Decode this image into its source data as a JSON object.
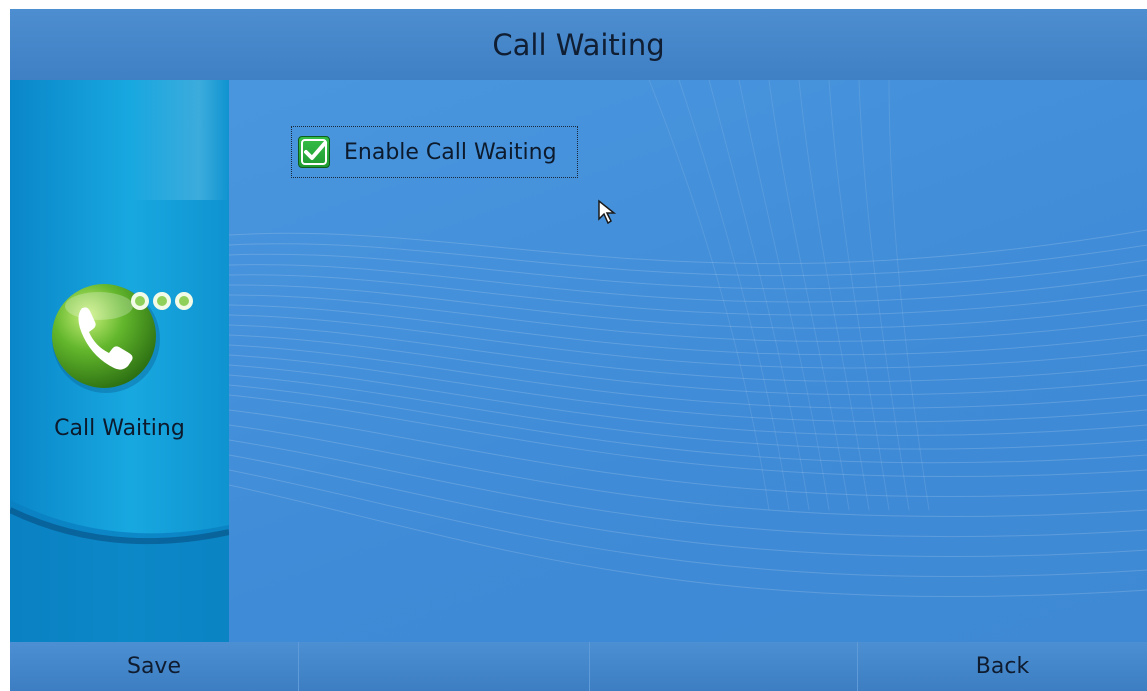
{
  "header": {
    "title": "Call Waiting"
  },
  "sidebar": {
    "icon": "phone-bubble-icon",
    "label": "Call Waiting"
  },
  "options": [
    {
      "label": "Enable Call Waiting",
      "checked": true
    }
  ],
  "softkeys": [
    "Save",
    "",
    "",
    "Back"
  ],
  "colors": {
    "background": "#3f8ad4",
    "sidebar": "#18a8e0",
    "checkbox": "#2aac3c",
    "text": "#0c1a2c"
  }
}
